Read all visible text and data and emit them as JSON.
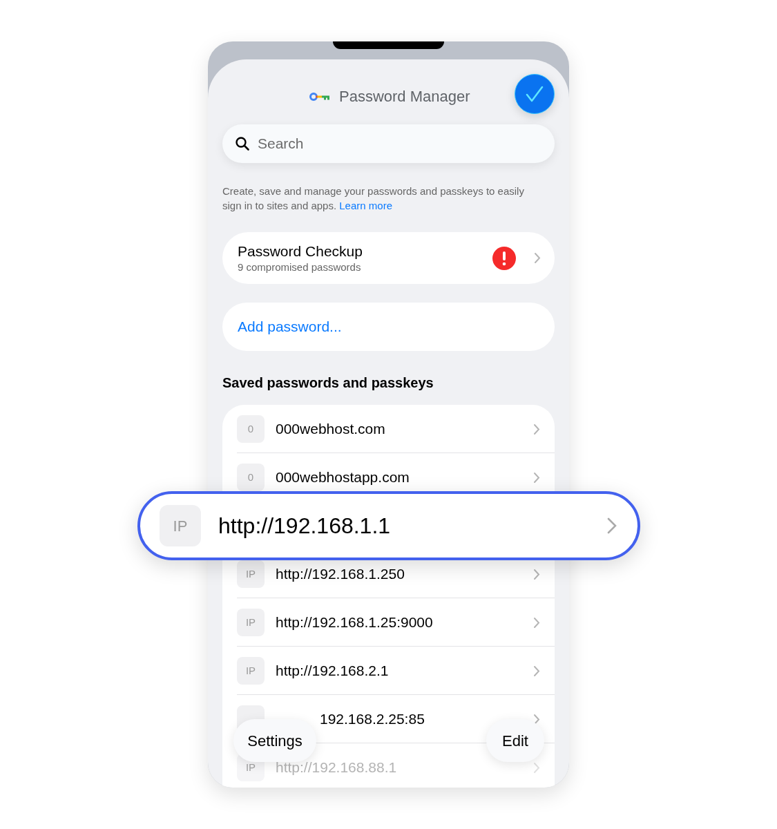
{
  "header": {
    "title": "Password Manager",
    "done_button": {
      "checked": true
    }
  },
  "search": {
    "placeholder": "Search"
  },
  "description": {
    "text": "Create, save and manage your passwords and passkeys to easily sign in to sites and apps.",
    "link": "Learn more"
  },
  "checkup": {
    "title": "Password Checkup",
    "subtitle": "9 compromised passwords",
    "warning": true
  },
  "add_password": "Add password...",
  "section_title": "Saved passwords and passkeys",
  "entries": [
    {
      "badge": "0",
      "name": "000webhost.com",
      "faded": false
    },
    {
      "badge": "0",
      "name": "000webhostapp.com",
      "faded": false
    },
    {
      "badge": "IP",
      "name": "http://192.168.1.250",
      "faded": false
    },
    {
      "badge": "IP",
      "name": "http://192.168.1.25:9000",
      "faded": false
    },
    {
      "badge": "IP",
      "name": "http://192.168.2.1",
      "faded": false
    },
    {
      "name": "192.168.2.25:85",
      "faded": false
    },
    {
      "badge": "IP",
      "name": "http://192.168.88.1",
      "faded": true
    }
  ],
  "highlighted_entry": {
    "badge": "IP",
    "name": "http://192.168.1.1"
  },
  "bottom_buttons": {
    "left": "Settings",
    "right": "Edit"
  }
}
